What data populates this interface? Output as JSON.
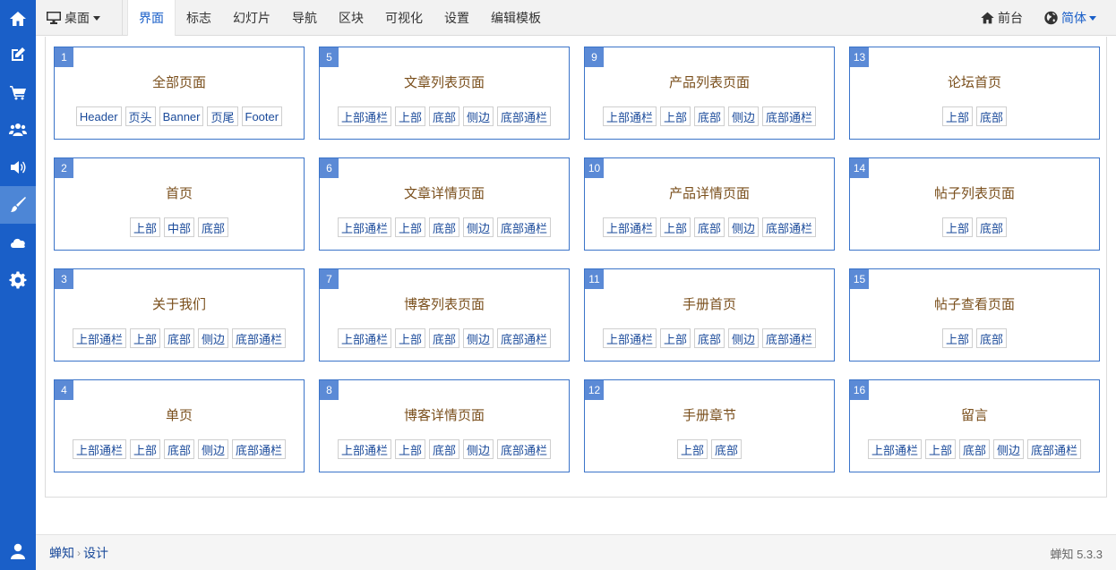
{
  "rail": {
    "items": [
      {
        "name": "home-icon"
      },
      {
        "name": "edit-icon"
      },
      {
        "name": "cart-icon"
      },
      {
        "name": "users-icon"
      },
      {
        "name": "volume-icon"
      },
      {
        "name": "brush-icon",
        "active": true
      },
      {
        "name": "cloud-icon"
      },
      {
        "name": "gear-icon"
      },
      {
        "name": "user-icon"
      }
    ]
  },
  "topbar": {
    "device_label": "桌面",
    "nav": [
      "界面",
      "标志",
      "幻灯片",
      "导航",
      "区块",
      "可视化",
      "设置",
      "编辑模板"
    ],
    "active_nav": "界面",
    "frontend_label": "前台",
    "lang_label": "简体"
  },
  "cards": [
    {
      "num": "1",
      "title": "全部页面",
      "tags": [
        "Header",
        "页头",
        "Banner",
        "页尾",
        "Footer"
      ]
    },
    {
      "num": "2",
      "title": "首页",
      "tags": [
        "上部",
        "中部",
        "底部"
      ]
    },
    {
      "num": "3",
      "title": "关于我们",
      "tags": [
        "上部通栏",
        "上部",
        "底部",
        "侧边",
        "底部通栏"
      ]
    },
    {
      "num": "4",
      "title": "单页",
      "tags": [
        "上部通栏",
        "上部",
        "底部",
        "侧边",
        "底部通栏"
      ]
    },
    {
      "num": "5",
      "title": "文章列表页面",
      "tags": [
        "上部通栏",
        "上部",
        "底部",
        "侧边",
        "底部通栏"
      ]
    },
    {
      "num": "6",
      "title": "文章详情页面",
      "tags": [
        "上部通栏",
        "上部",
        "底部",
        "侧边",
        "底部通栏"
      ]
    },
    {
      "num": "7",
      "title": "博客列表页面",
      "tags": [
        "上部通栏",
        "上部",
        "底部",
        "侧边",
        "底部通栏"
      ]
    },
    {
      "num": "8",
      "title": "博客详情页面",
      "tags": [
        "上部通栏",
        "上部",
        "底部",
        "侧边",
        "底部通栏"
      ]
    },
    {
      "num": "9",
      "title": "产品列表页面",
      "tags": [
        "上部通栏",
        "上部",
        "底部",
        "侧边",
        "底部通栏"
      ]
    },
    {
      "num": "10",
      "title": "产品详情页面",
      "tags": [
        "上部通栏",
        "上部",
        "底部",
        "侧边",
        "底部通栏"
      ]
    },
    {
      "num": "11",
      "title": "手册首页",
      "tags": [
        "上部通栏",
        "上部",
        "底部",
        "侧边",
        "底部通栏"
      ]
    },
    {
      "num": "12",
      "title": "手册章节",
      "tags": [
        "上部",
        "底部"
      ]
    },
    {
      "num": "13",
      "title": "论坛首页",
      "tags": [
        "上部",
        "底部"
      ]
    },
    {
      "num": "14",
      "title": "帖子列表页面",
      "tags": [
        "上部",
        "底部"
      ]
    },
    {
      "num": "15",
      "title": "帖子查看页面",
      "tags": [
        "上部",
        "底部"
      ]
    },
    {
      "num": "16",
      "title": "留言",
      "tags": [
        "上部通栏",
        "上部",
        "底部",
        "侧边",
        "底部通栏"
      ]
    }
  ],
  "footer": {
    "breadcrumb": [
      "蝉知",
      "设计"
    ],
    "version": "蝉知 5.3.3"
  },
  "colors": {
    "rail_bg": "#1a5fc8",
    "accent": "#1a5fc8",
    "card_border": "#3b74c9",
    "card_title": "#7a4f1c"
  }
}
